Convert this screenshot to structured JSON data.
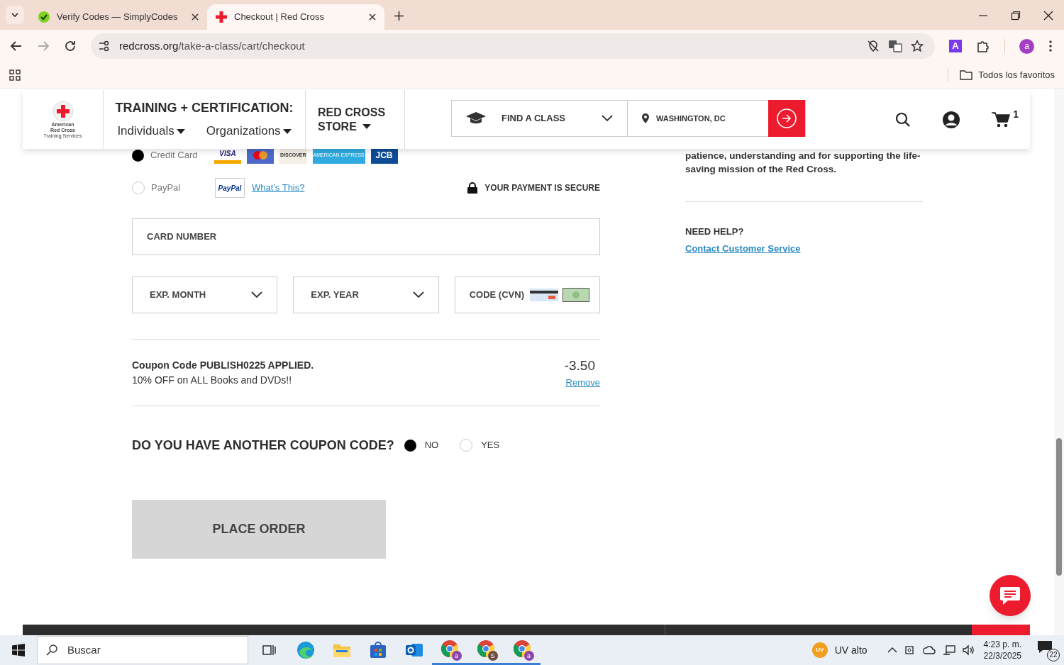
{
  "browser": {
    "tabs": [
      {
        "title": "Verify Codes — SimplyCodes",
        "selected": false,
        "kind": "simplycodes"
      },
      {
        "title": "Checkout | Red Cross",
        "selected": true,
        "kind": "redcross"
      }
    ],
    "url_host": "redcross.org",
    "url_path": "/take-a-class/cart/checkout",
    "profile_initial": "a",
    "extension_letter": "A",
    "bookmarks": [
      "Todos los favoritos"
    ]
  },
  "header": {
    "logo_lines": [
      "American",
      "Red Cross",
      "Training Services"
    ],
    "training_title": "TRAINING + CERTIFICATION:",
    "menus": [
      "Individuals",
      "Organizations"
    ],
    "store_lines": [
      "RED CROSS",
      "STORE"
    ],
    "find_class": "FIND A CLASS",
    "location": "WASHINGTON, DC",
    "cart_count": "1"
  },
  "payment": {
    "methods": [
      {
        "label": "Credit Card",
        "selected": true,
        "kind": "card"
      },
      {
        "label": "PayPal",
        "selected": false,
        "kind": "paypal"
      }
    ],
    "card_logos": [
      {
        "kind": "visa",
        "text": "VISA"
      },
      {
        "kind": "mastercard"
      },
      {
        "kind": "discover",
        "text": "DISCOVER"
      },
      {
        "kind": "amex",
        "text": "AMERICAN EXPRESS"
      },
      {
        "kind": "jcb",
        "text": "JCB"
      }
    ],
    "paypal_logo": "PayPal",
    "whats_this": "What's This?",
    "secure": "YOUR PAYMENT IS SECURE"
  },
  "fields": {
    "card_number": {
      "placeholder": "CARD NUMBER"
    },
    "exp_month": {
      "placeholder": "EXP. MONTH"
    },
    "exp_year": {
      "placeholder": "EXP. YEAR"
    },
    "cvn": {
      "placeholder": "CODE (CVN)"
    }
  },
  "coupon": {
    "title": "Coupon Code PUBLISH0225 APPLIED.",
    "description": "10% OFF on ALL Books and DVDs!!",
    "amount": "-3.50",
    "remove": "Remove"
  },
  "another_coupon": {
    "question": "DO YOU HAVE ANOTHER COUPON CODE?",
    "options": [
      {
        "label": "NO",
        "selected": true
      },
      {
        "label": "YES",
        "selected": false
      }
    ]
  },
  "place_order": "PLACE ORDER",
  "sidebar": {
    "message": "patience, understanding and for supporting the life-saving mission of the Red Cross.",
    "help_title": "NEED HELP?",
    "help_link": "Contact Customer Service"
  },
  "taskbar": {
    "search": "Buscar",
    "apps": [
      {
        "kind": "taskview"
      },
      {
        "kind": "edge"
      },
      {
        "kind": "explorer"
      },
      {
        "kind": "store"
      },
      {
        "kind": "outlook"
      },
      {
        "kind": "chrome",
        "badge": "a",
        "color": "#8e44ad"
      },
      {
        "kind": "chrome",
        "badge": "S",
        "color": "#6d4c41"
      },
      {
        "kind": "chrome",
        "badge": "a",
        "color": "#8e44ad"
      }
    ],
    "weather_badge": "UV",
    "weather": "UV alto",
    "time": "4:23 p. m.",
    "date": "22/3/2025",
    "notifications": "22"
  }
}
